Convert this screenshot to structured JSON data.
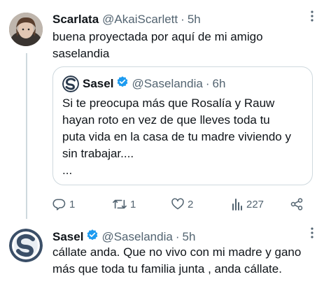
{
  "tweet1": {
    "name": "Scarlata",
    "handle": "@AkaiScarlett",
    "dot": "·",
    "time": "5h",
    "text_line1": "buena proyectada por aquí de mi amigo",
    "text_line2": "saselandia"
  },
  "quote": {
    "name": "Sasel",
    "handle": "@Saselandia",
    "dot": "·",
    "time": "6h",
    "lines": [
      "Si te preocupa más que Rosalía y Rauw",
      "hayan roto en vez de que lleves toda tu",
      "puta vida en la casa de tu madre viviendo y",
      "sin trabajar....",
      "..."
    ]
  },
  "actions": {
    "reply_count": "1",
    "retweet_count": "1",
    "like_count": "2",
    "views_count": "227"
  },
  "tweet2": {
    "name": "Sasel",
    "handle": "@Saselandia",
    "dot": "·",
    "time": "5h",
    "text_line1": "cállate anda. Que no vivo con mi madre y gano",
    "text_line2": "más que toda tu familia junta , anda cállate."
  },
  "colors": {
    "verified": "#1d9bf0",
    "muted": "#536471",
    "text": "#0f1419",
    "border": "#cfd9de"
  },
  "icons": [
    "more-icon",
    "verified-icon",
    "reply-icon",
    "retweet-icon",
    "like-icon",
    "views-icon",
    "share-icon"
  ]
}
